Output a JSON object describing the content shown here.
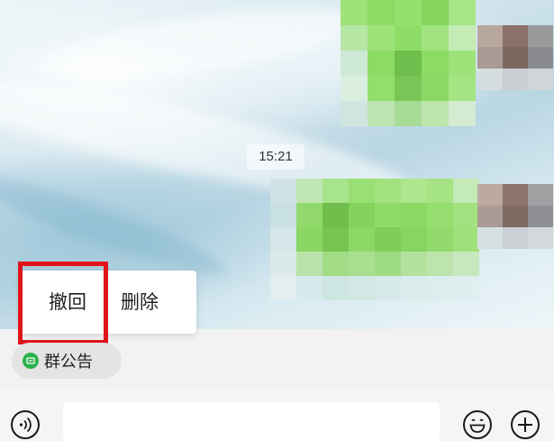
{
  "chat": {
    "timestamp": "15:21",
    "messages": [
      {
        "sender": "self",
        "content": "pixelated"
      },
      {
        "sender": "self",
        "content": "pixelated"
      }
    ]
  },
  "context_menu": {
    "recall_label": "撤回",
    "delete_label": "删除",
    "highlighted_item": "撤回",
    "highlight_color": "#e0141a"
  },
  "announcement": {
    "label": "群公告",
    "icon": "announcement-icon",
    "icon_color": "#2bb24c"
  },
  "input_bar": {
    "text_value": "",
    "voice_icon": "voice-icon",
    "emoji_icon": "emoji-icon",
    "plus_icon": "plus-icon"
  },
  "colors": {
    "bubble_green": "#95ec69",
    "background": "#f2f2f2"
  }
}
